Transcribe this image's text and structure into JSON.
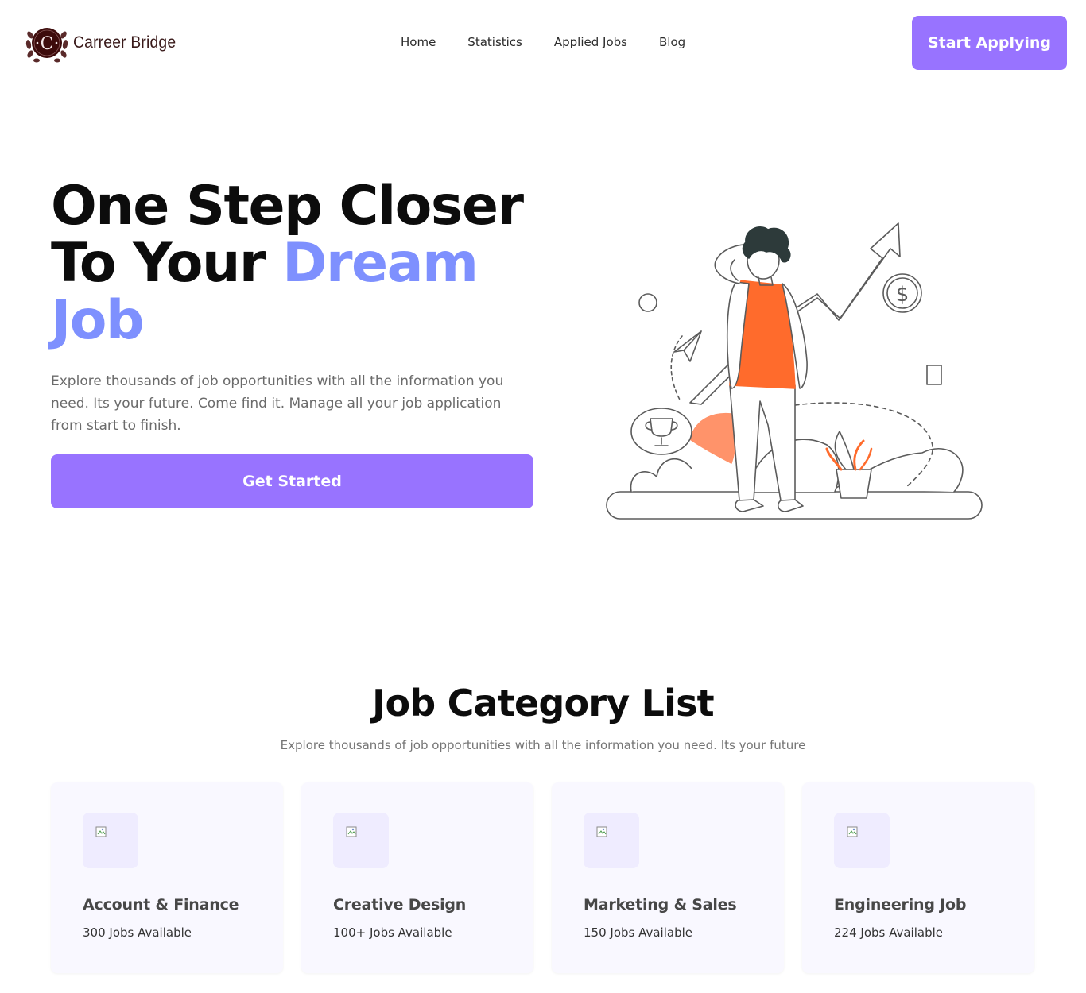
{
  "nav": {
    "brand_name": "Carreer Bridge",
    "brand_initial": "C",
    "links": [
      "Home",
      "Statistics",
      "Applied Jobs",
      "Blog"
    ],
    "cta_label": "Start Applying"
  },
  "hero": {
    "title_line1": "One Step Closer",
    "title_line2_plain": "To Your ",
    "title_line2_accent": "Dream",
    "title_line3_accent": "Job",
    "description": "Explore thousands of job opportunities with all the information you need. Its your future. Come find it. Manage all your job application from start to finish.",
    "cta_label": "Get Started",
    "illustration_icon": "person-career-growth-illustration"
  },
  "categories": {
    "title": "Job Category List",
    "subtitle": "Explore thousands of job opportunities with all the information you need. Its your future",
    "items": [
      {
        "title": "Account & Finance",
        "count": "300 Jobs Available",
        "icon": "broken-image-icon"
      },
      {
        "title": "Creative Design",
        "count": "100+ Jobs Available",
        "icon": "broken-image-icon"
      },
      {
        "title": "Marketing & Sales",
        "count": "150 Jobs Available",
        "icon": "broken-image-icon"
      },
      {
        "title": "Engineering Job",
        "count": "224 Jobs Available",
        "icon": "broken-image-icon"
      }
    ]
  },
  "colors": {
    "primary": "#9873ff",
    "accent_text": "#7e90fe",
    "card_bg": "#f9f8ff",
    "icon_bg": "#efecff",
    "illustration_orange": "#ff6b2c"
  }
}
